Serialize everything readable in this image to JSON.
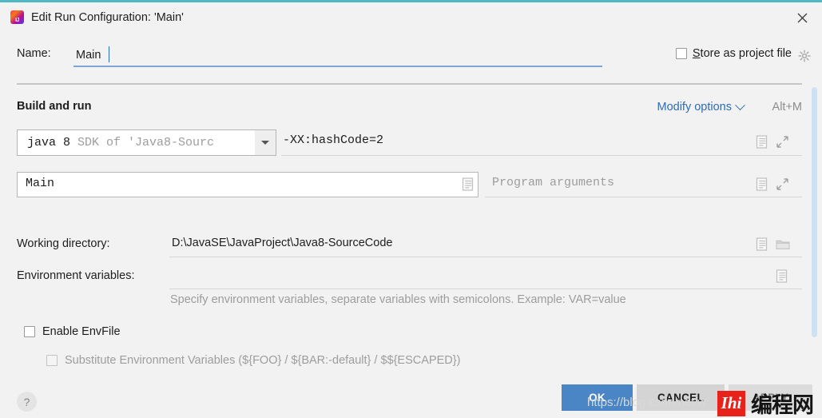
{
  "window": {
    "title": "Edit Run Configuration: 'Main'",
    "app_icon": "intellij-idea-icon",
    "close_icon": "close-icon",
    "accent_color": "#4fb8c4"
  },
  "name_row": {
    "label": "Name:",
    "value": "Main",
    "store_as_project_file": {
      "label_prefix": "",
      "mnemonic": "S",
      "label_rest": "tore as project file",
      "checked": false
    },
    "gear_icon": "gear-icon"
  },
  "build_and_run": {
    "section_title": "Build and run",
    "modify_options_label": "Modify options",
    "modify_options_chevron": "chevron-down-icon",
    "modify_options_shortcut": "Alt+M",
    "jdk": {
      "name": "java 8",
      "description": "SDK of 'Java8-Sourc",
      "dropdown_icon": "chevron-down-icon"
    },
    "vm_options": {
      "value": "-XX:hashCode=2",
      "macro_icon": "document-icon",
      "expand_icon": "expand-icon"
    },
    "main_class": {
      "value": "Main",
      "macro_icon": "document-icon"
    },
    "program_arguments": {
      "placeholder": "Program arguments",
      "value": "",
      "macro_icon": "document-icon",
      "expand_icon": "expand-icon"
    }
  },
  "working_directory": {
    "label": "Working directory:",
    "value": "D:\\JavaSE\\JavaProject\\Java8-SourceCode",
    "macro_icon": "document-icon",
    "browse_icon": "folder-icon"
  },
  "environment_variables": {
    "label": "Environment variables:",
    "value": "",
    "hint": "Specify environment variables, separate variables with semicolons. Example: VAR=value",
    "browse_icon": "document-icon"
  },
  "envfile": {
    "enable_label": "Enable EnvFile",
    "enable_checked": false,
    "substitute_label": "Substitute Environment Variables (${FOO} / ${BAR:-default} / $${ESCAPED})",
    "substitute_checked": false,
    "substitute_disabled": true
  },
  "footer": {
    "help_label": "?",
    "ok_label": "OK",
    "cancel_label": "CANCEL",
    "apply_label": "APPLY",
    "ok_color": "#4a86c5"
  },
  "watermark": {
    "url": "https://blog.csdn.net/w",
    "logo_mark": "Ihi",
    "logo_text": "编程网"
  },
  "scrollbar": {
    "thumb_color": "#cfe1f2"
  }
}
